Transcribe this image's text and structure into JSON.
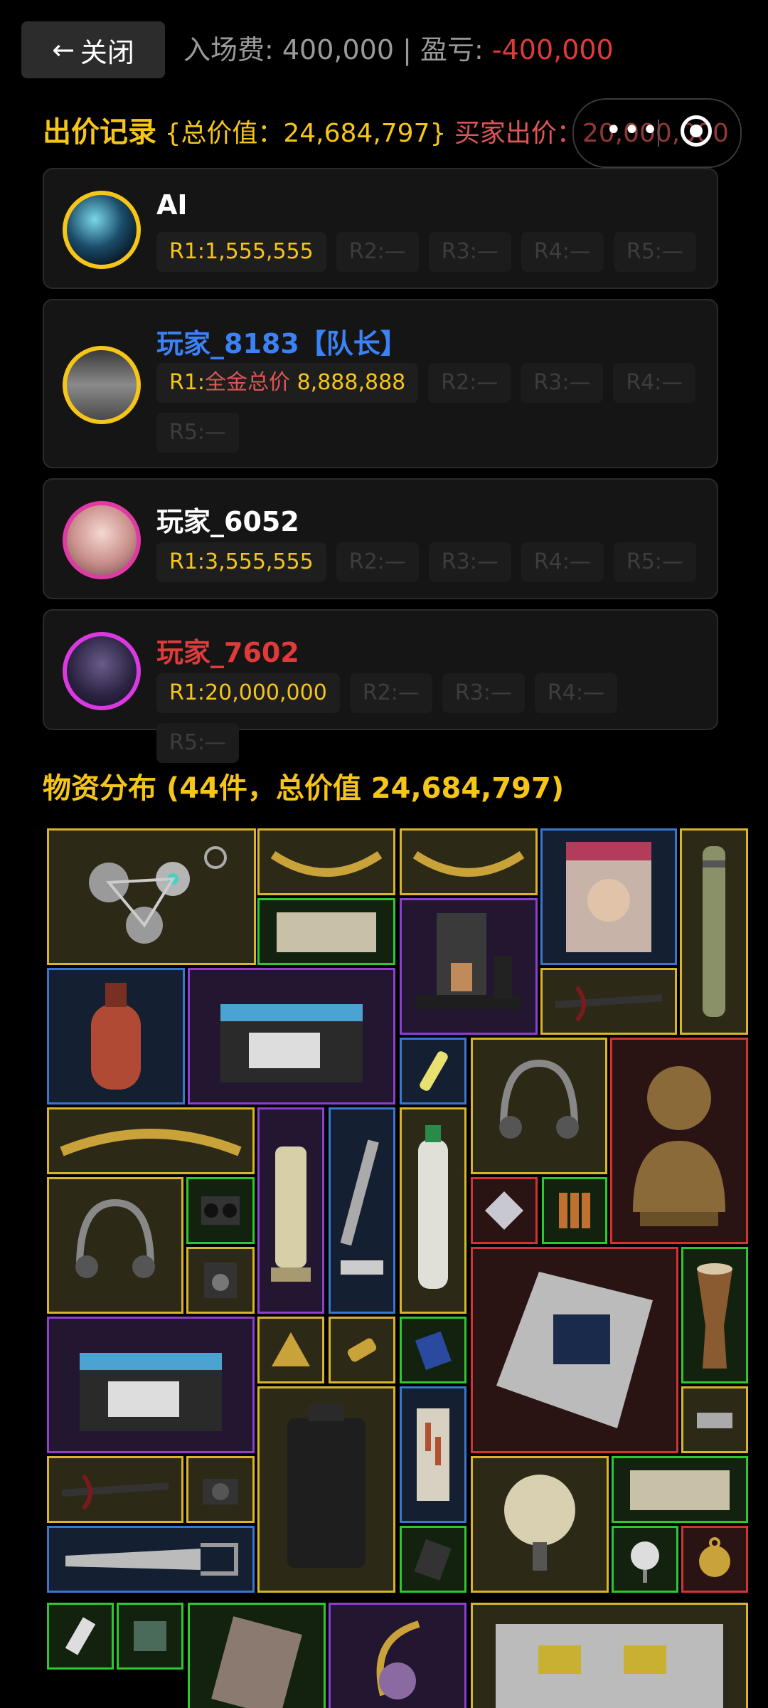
{
  "topbar": {
    "close_arrow": "←",
    "close_label": "关闭",
    "fee_label": "入场费: 400,000 | 盈亏: ",
    "profit_value": "-400,000"
  },
  "capsule": {
    "more_icon": "more-dots-icon",
    "target_icon": "target-icon",
    "dots": "•••"
  },
  "bids": {
    "title": "出价记录",
    "total_label": "{总价值：24,684,797}",
    "buyer_label": "买家出价：20,000,000",
    "players": [
      {
        "name": "AI",
        "name_color": "#ffffff",
        "rounds": [
          "R1:1,555,555",
          "R2:—",
          "R3:—",
          "R4:—",
          "R5:—"
        ]
      },
      {
        "name": "玩家_8183【队长】",
        "name_color": "#3b82f6",
        "round1_prefix": "R1:",
        "round1_red": "全金总价",
        "round1_value": " 8,888,888",
        "rounds": [
          "R2:—",
          "R3:—",
          "R4:—",
          "R5:—"
        ]
      },
      {
        "name": "玩家_6052",
        "name_color": "#ffffff",
        "rounds": [
          "R1:3,555,555",
          "R2:—",
          "R3:—",
          "R4:—",
          "R5:—"
        ]
      },
      {
        "name": "玩家_7602",
        "name_color": "#e03a3a",
        "rounds": [
          "R1:20,000,000",
          "R2:—",
          "R3:—",
          "R4:—",
          "R5:—"
        ]
      }
    ]
  },
  "distribution": {
    "title": "物资分布 (44件，总价值 24,684,797)"
  },
  "colors": {
    "accent_gold": "#f5c518",
    "loss_red": "#e03a3a",
    "rarity_gold": "#d8b42a",
    "rarity_green": "#2fc72f",
    "rarity_blue": "#3a76d0",
    "rarity_purple": "#8e3fd0",
    "rarity_red": "#d23434"
  }
}
